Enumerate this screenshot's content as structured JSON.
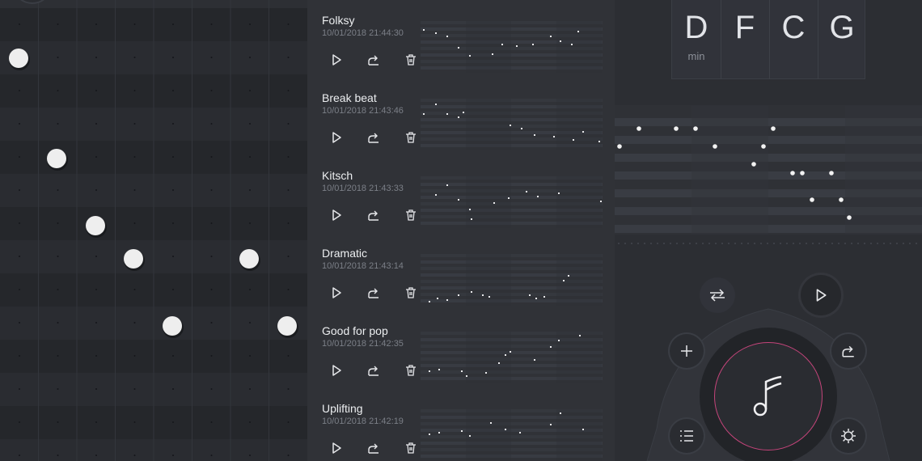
{
  "songs": [
    {
      "title": "Folksy",
      "date": "10/01/2018 21:44:30"
    },
    {
      "title": "Break beat",
      "date": "10/01/2018 21:43:46"
    },
    {
      "title": "Kitsch",
      "date": "10/01/2018 21:43:33"
    },
    {
      "title": "Dramatic",
      "date": "10/01/2018 21:43:14"
    },
    {
      "title": "Good for pop",
      "date": "10/01/2018 21:42:35"
    },
    {
      "title": "Uplifting",
      "date": "10/01/2018 21:42:19"
    }
  ],
  "chords": [
    {
      "letter": "D",
      "sub": "min"
    },
    {
      "letter": "F",
      "sub": ""
    },
    {
      "letter": "C",
      "sub": ""
    },
    {
      "letter": "G",
      "sub": ""
    }
  ],
  "icons": {
    "play": "play-icon",
    "share": "share-icon",
    "delete": "trash-icon",
    "loop": "repeat-icon",
    "add": "add-icon",
    "list": "list-icon",
    "settings": "gear-icon",
    "music": "music-note-icon"
  },
  "colors": {
    "accent_ring": "#c4447a",
    "note": "#f2f2f2"
  }
}
